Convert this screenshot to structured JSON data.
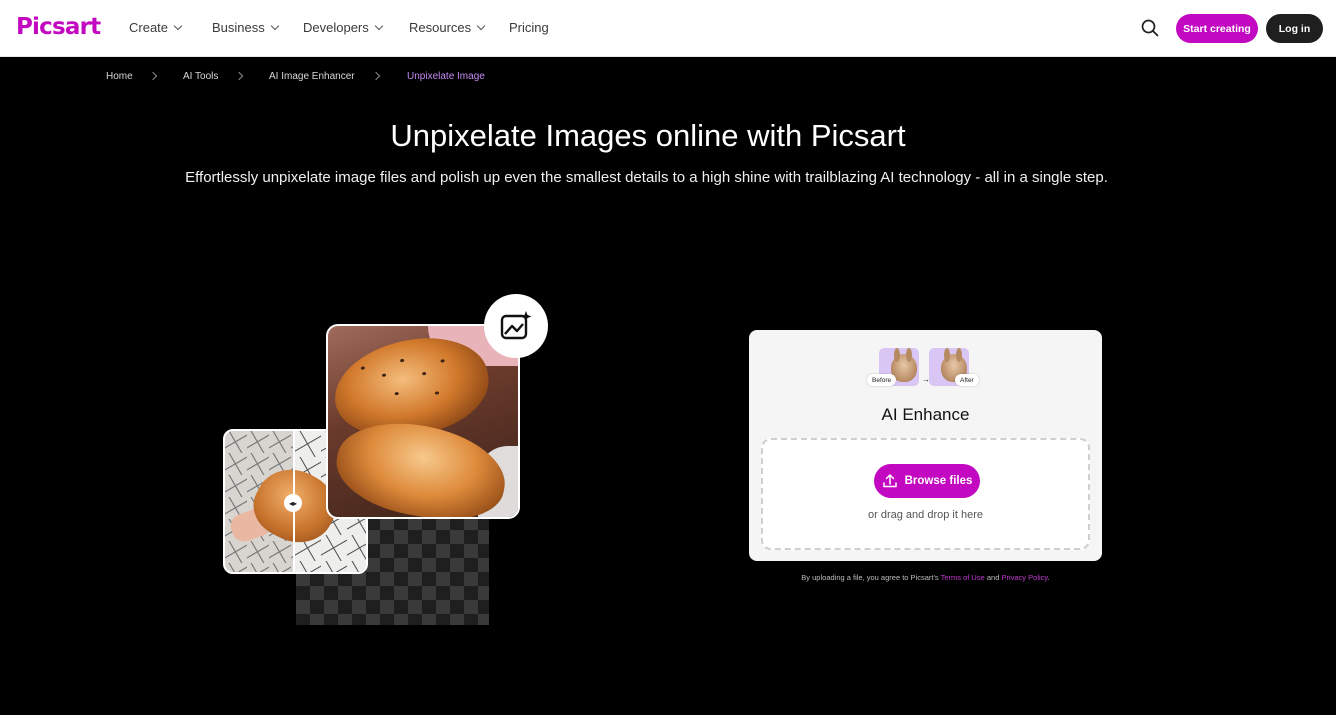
{
  "header": {
    "logo": "Picsart",
    "nav": [
      {
        "label": "Create",
        "dropdown": true
      },
      {
        "label": "Business",
        "dropdown": true
      },
      {
        "label": "Developers",
        "dropdown": true
      },
      {
        "label": "Resources",
        "dropdown": true
      },
      {
        "label": "Pricing",
        "dropdown": false
      }
    ],
    "search_icon": "search-icon",
    "start_creating": "Start creating",
    "log_in": "Log in"
  },
  "breadcrumb": [
    "Home",
    "AI Tools",
    "AI Image Enhancer",
    "Unpixelate Image"
  ],
  "hero": {
    "title": "Unpixelate Images online with Picsart",
    "subtitle": "Effortlessly unpixelate image files and polish up even the smallest details to a high shine with trailblazing AI technology - all in a single step."
  },
  "upload": {
    "before_label": "Before",
    "after_label": "After",
    "title": "AI Enhance",
    "browse_label": "Browse files",
    "drag_text": "or drag and drop it here",
    "terms_prefix": "By uploading a file, you agree to Picsart's ",
    "terms_link": "Terms of Use",
    "terms_and": " and ",
    "privacy_link": "Privacy Policy",
    "terms_suffix": "."
  },
  "colors": {
    "brand": "#c209c1",
    "breadcrumb_active": "#c68bf5",
    "background": "#000000"
  }
}
